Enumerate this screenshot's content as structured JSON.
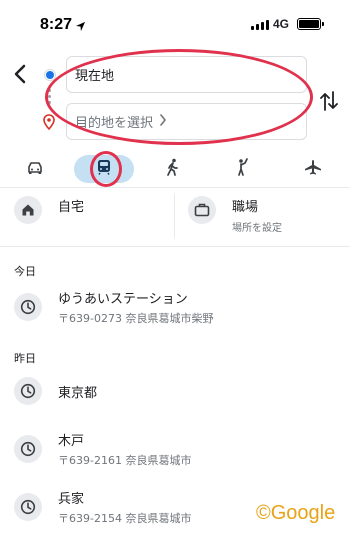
{
  "status_bar": {
    "time": "8:27",
    "network": "4G",
    "icons": [
      "location-arrow-icon",
      "signal-icon",
      "battery-icon"
    ]
  },
  "route": {
    "origin_value": "現在地",
    "destination_placeholder": "目的地を選択",
    "icons": [
      "back-arrow-icon",
      "origin-dot-icon",
      "destination-pin-icon",
      "swap-icon",
      "chevron-right-icon"
    ]
  },
  "modes": [
    {
      "name": "car",
      "icon": "car-icon",
      "active": false
    },
    {
      "name": "transit",
      "icon": "train-icon",
      "active": true
    },
    {
      "name": "walk",
      "icon": "walk-icon",
      "active": false
    },
    {
      "name": "ride",
      "icon": "hail-icon",
      "active": false
    },
    {
      "name": "flight",
      "icon": "airplane-icon",
      "active": false
    }
  ],
  "saved": {
    "home": {
      "label": "自宅",
      "icon": "home-icon"
    },
    "work": {
      "label": "職場",
      "sublabel": "場所を設定",
      "icon": "briefcase-icon"
    }
  },
  "history": {
    "today_label": "今日",
    "yesterday_label": "昨日",
    "items": [
      {
        "title": "ゆうあいステーション",
        "address": "〒639-0273 奈良県葛城市柴野",
        "icon": "clock-icon"
      },
      {
        "title": "東京都",
        "address": "",
        "icon": "clock-icon"
      },
      {
        "title": "木戸",
        "address": "〒639-2161 奈良県葛城市",
        "icon": "clock-icon"
      },
      {
        "title": "兵家",
        "address": "〒639-2154 奈良県葛城市",
        "icon": "clock-icon"
      }
    ]
  },
  "watermark": "©Google",
  "colors": {
    "accent": "#1a73e8",
    "highlight": "#e0314d",
    "active_tab": "#c5e0f2",
    "watermark": "#e8a317"
  }
}
